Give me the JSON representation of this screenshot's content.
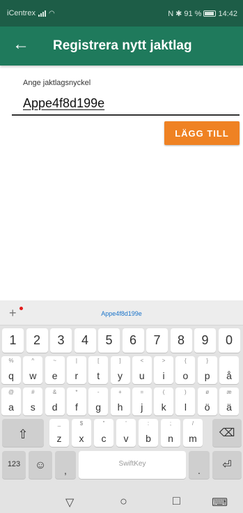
{
  "status": {
    "carrier": "iCentrex",
    "battery_pct": "91 %",
    "time": "14:42",
    "nfc": "N",
    "bt": "✱"
  },
  "appbar": {
    "back_glyph": "←",
    "title": "Registrera nytt jaktlag"
  },
  "form": {
    "label": "Ange jaktlagsnyckel",
    "value": "Appe4f8d199e",
    "button": "LÄGG TILL"
  },
  "keyboard": {
    "suggestion": "Appe4f8d199e",
    "plus": "+",
    "numbers": [
      "1",
      "2",
      "3",
      "4",
      "5",
      "6",
      "7",
      "8",
      "9",
      "0"
    ],
    "row1": [
      [
        "q",
        "%"
      ],
      [
        "w",
        "^"
      ],
      [
        "e",
        "~"
      ],
      [
        "r",
        "|"
      ],
      [
        "t",
        "["
      ],
      [
        "y",
        "]"
      ],
      [
        "u",
        "<"
      ],
      [
        "i",
        ">"
      ],
      [
        "o",
        "{"
      ],
      [
        "p",
        "}"
      ],
      [
        "å",
        ""
      ]
    ],
    "row2": [
      [
        "a",
        "@"
      ],
      [
        "s",
        "#"
      ],
      [
        "d",
        "&"
      ],
      [
        "f",
        "*"
      ],
      [
        "g",
        "-"
      ],
      [
        "h",
        "+"
      ],
      [
        "j",
        "="
      ],
      [
        "k",
        "("
      ],
      [
        "l",
        ")"
      ],
      [
        "ö",
        "ø"
      ],
      [
        "ä",
        "æ"
      ]
    ],
    "row3": [
      [
        "z",
        "_"
      ],
      [
        "x",
        "$"
      ],
      [
        "c",
        "\""
      ],
      [
        "v",
        "'"
      ],
      [
        "b",
        ":"
      ],
      [
        "n",
        ";"
      ],
      [
        "m",
        "/"
      ]
    ],
    "shift": "⇧",
    "backspace": "⌫",
    "num_label": "123",
    "emoji": "☺",
    "comma": ",",
    "space": "SwiftKey",
    "period": ".",
    "enter": "⏎"
  },
  "nav": {
    "back": "▽",
    "home": "○",
    "recents": "□",
    "keyboard": "⌨"
  }
}
